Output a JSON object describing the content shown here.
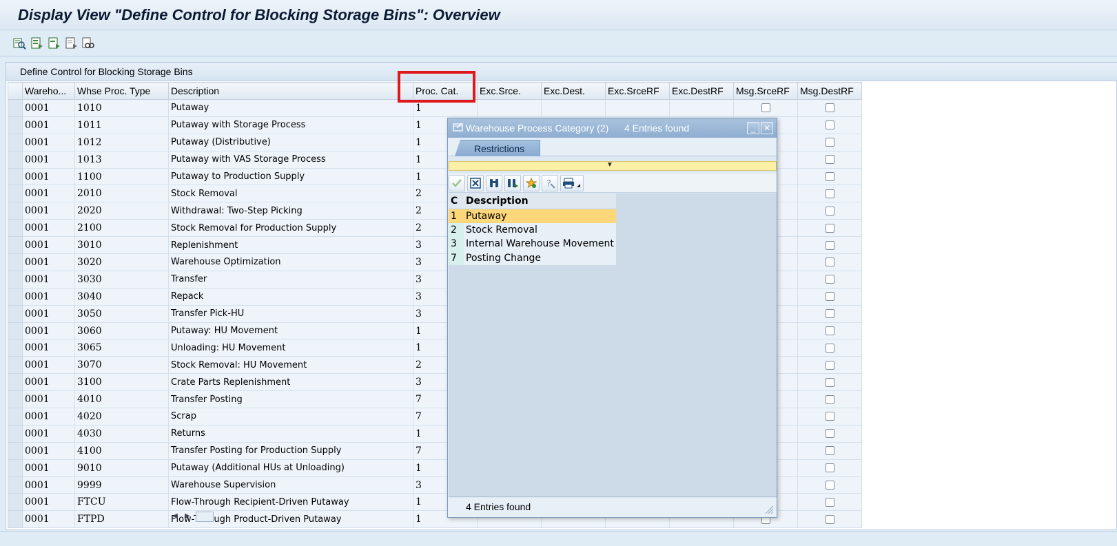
{
  "window": {
    "title": "Display View \"Define Control for Blocking Storage Bins\": Overview"
  },
  "toolbar": {
    "icons": [
      "details-icon",
      "select-all-icon",
      "select-block-icon",
      "deselect-all-icon",
      "find-icon"
    ]
  },
  "panel": {
    "title": "Define Control for Blocking Storage Bins"
  },
  "table": {
    "columns": [
      "Wareho...",
      "Whse Proc. Type",
      "Description",
      "Proc. Cat.",
      "Exc.Srce.",
      "Exc.Dest.",
      "Exc.SrceRF",
      "Exc.DestRF",
      "Msg.SrceRF",
      "Msg.DestRF"
    ],
    "rows": [
      {
        "wh": "0001",
        "type": "1010",
        "desc": "Putaway",
        "cat": "1"
      },
      {
        "wh": "0001",
        "type": "1011",
        "desc": "Putaway with Storage Process",
        "cat": "1"
      },
      {
        "wh": "0001",
        "type": "1012",
        "desc": "Putaway (Distributive)",
        "cat": "1"
      },
      {
        "wh": "0001",
        "type": "1013",
        "desc": "Putaway with VAS Storage Process",
        "cat": "1"
      },
      {
        "wh": "0001",
        "type": "1100",
        "desc": "Putaway to Production Supply",
        "cat": "1"
      },
      {
        "wh": "0001",
        "type": "2010",
        "desc": "Stock Removal",
        "cat": "2"
      },
      {
        "wh": "0001",
        "type": "2020",
        "desc": "Withdrawal: Two-Step Picking",
        "cat": "2"
      },
      {
        "wh": "0001",
        "type": "2100",
        "desc": "Stock Removal for Production Supply",
        "cat": "2"
      },
      {
        "wh": "0001",
        "type": "3010",
        "desc": "Replenishment",
        "cat": "3"
      },
      {
        "wh": "0001",
        "type": "3020",
        "desc": "Warehouse Optimization",
        "cat": "3"
      },
      {
        "wh": "0001",
        "type": "3030",
        "desc": "Transfer",
        "cat": "3"
      },
      {
        "wh": "0001",
        "type": "3040",
        "desc": "Repack",
        "cat": "3"
      },
      {
        "wh": "0001",
        "type": "3050",
        "desc": "Transfer Pick-HU",
        "cat": "3"
      },
      {
        "wh": "0001",
        "type": "3060",
        "desc": "Putaway: HU Movement",
        "cat": "1"
      },
      {
        "wh": "0001",
        "type": "3065",
        "desc": "Unloading: HU Movement",
        "cat": "1"
      },
      {
        "wh": "0001",
        "type": "3070",
        "desc": "Stock Removal: HU Movement",
        "cat": "2"
      },
      {
        "wh": "0001",
        "type": "3100",
        "desc": "Crate Parts Replenishment",
        "cat": "3"
      },
      {
        "wh": "0001",
        "type": "4010",
        "desc": "Transfer Posting",
        "cat": "7"
      },
      {
        "wh": "0001",
        "type": "4020",
        "desc": "Scrap",
        "cat": "7"
      },
      {
        "wh": "0001",
        "type": "4030",
        "desc": "Returns",
        "cat": "1"
      },
      {
        "wh": "0001",
        "type": "4100",
        "desc": "Transfer Posting for Production Supply",
        "cat": "7"
      },
      {
        "wh": "0001",
        "type": "9010",
        "desc": "Putaway (Additional HUs at Unloading)",
        "cat": "1"
      },
      {
        "wh": "0001",
        "type": "9999",
        "desc": "Warehouse Supervision",
        "cat": "3"
      },
      {
        "wh": "0001",
        "type": "FTCU",
        "desc": "Flow-Through Recipient-Driven Putaway",
        "cat": "1"
      },
      {
        "wh": "0001",
        "type": "FTPD",
        "desc": "Flow-Through Product-Driven Putaway",
        "cat": "1"
      }
    ]
  },
  "popup": {
    "title": "Warehouse Process Category (2)",
    "count": "4 Entries found",
    "tab": "Restrictions",
    "columns": [
      "C",
      "Description"
    ],
    "items": [
      {
        "code": "1",
        "label": "Putaway",
        "selected": true
      },
      {
        "code": "2",
        "label": "Stock Removal",
        "selected": false
      },
      {
        "code": "3",
        "label": "Internal Warehouse Movement",
        "selected": false
      },
      {
        "code": "7",
        "label": "Posting Change",
        "selected": false
      }
    ],
    "footer": "4 Entries found",
    "buttons": [
      "confirm-icon",
      "cancel-icon",
      "find-icon",
      "find-next-icon",
      "add-favorite-icon",
      "help-icon",
      "print-icon"
    ]
  },
  "colors": {
    "highlight": "#e0181b",
    "selected_row": "#fdd77a"
  }
}
